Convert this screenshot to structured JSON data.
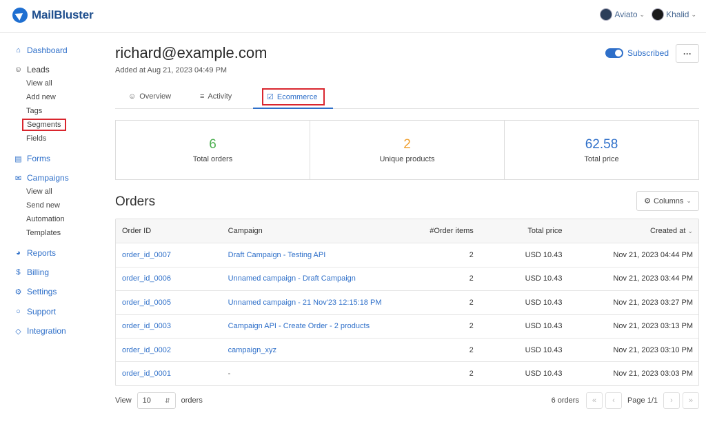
{
  "brand": {
    "name": "MailBluster"
  },
  "accounts": [
    {
      "name": "Aviato"
    },
    {
      "name": "Khalid"
    }
  ],
  "sidebar": {
    "dashboard": "Dashboard",
    "leads": "Leads",
    "leads_items": [
      "View all",
      "Add new",
      "Tags",
      "Segments",
      "Fields"
    ],
    "forms": "Forms",
    "campaigns": "Campaigns",
    "campaigns_items": [
      "View all",
      "Send new",
      "Automation",
      "Templates"
    ],
    "reports": "Reports",
    "billing": "Billing",
    "settings": "Settings",
    "support": "Support",
    "integration": "Integration"
  },
  "lead": {
    "email": "richard@example.com",
    "added": "Added at Aug 21, 2023 04:49 PM",
    "status": "Subscribed",
    "more": "···"
  },
  "tabs": [
    "Overview",
    "Activity",
    "Ecommerce"
  ],
  "stats": [
    {
      "value": "6",
      "label": "Total orders",
      "color": "#4caf50"
    },
    {
      "value": "2",
      "label": "Unique products",
      "color": "#f0a030"
    },
    {
      "value": "62.58",
      "label": "Total price",
      "color": "#2e6fc9"
    }
  ],
  "orders": {
    "title": "Orders",
    "columns_button": "Columns",
    "headers": [
      "Order ID",
      "Campaign",
      "#Order items",
      "Total price",
      "Created at"
    ],
    "rows": [
      {
        "id": "order_id_0007",
        "campaign": "Draft Campaign - Testing API",
        "items": "2",
        "price": "USD 10.43",
        "created": "Nov 21, 2023 04:44 PM"
      },
      {
        "id": "order_id_0006",
        "campaign": "Unnamed campaign - Draft Campaign",
        "items": "2",
        "price": "USD 10.43",
        "created": "Nov 21, 2023 03:44 PM"
      },
      {
        "id": "order_id_0005",
        "campaign": "Unnamed campaign - 21 Nov'23 12:15:18 PM",
        "items": "2",
        "price": "USD 10.43",
        "created": "Nov 21, 2023 03:27 PM"
      },
      {
        "id": "order_id_0003",
        "campaign": "Campaign API - Create Order - 2 products",
        "items": "2",
        "price": "USD 10.43",
        "created": "Nov 21, 2023 03:13 PM"
      },
      {
        "id": "order_id_0002",
        "campaign": "campaign_xyz",
        "items": "2",
        "price": "USD 10.43",
        "created": "Nov 21, 2023 03:10 PM"
      },
      {
        "id": "order_id_0001",
        "campaign": "-",
        "items": "2",
        "price": "USD 10.43",
        "created": "Nov 21, 2023 03:03 PM"
      }
    ]
  },
  "footer": {
    "view_label": "View",
    "page_size": "10",
    "unit": "orders",
    "count": "6 orders",
    "page": "Page 1/1"
  }
}
